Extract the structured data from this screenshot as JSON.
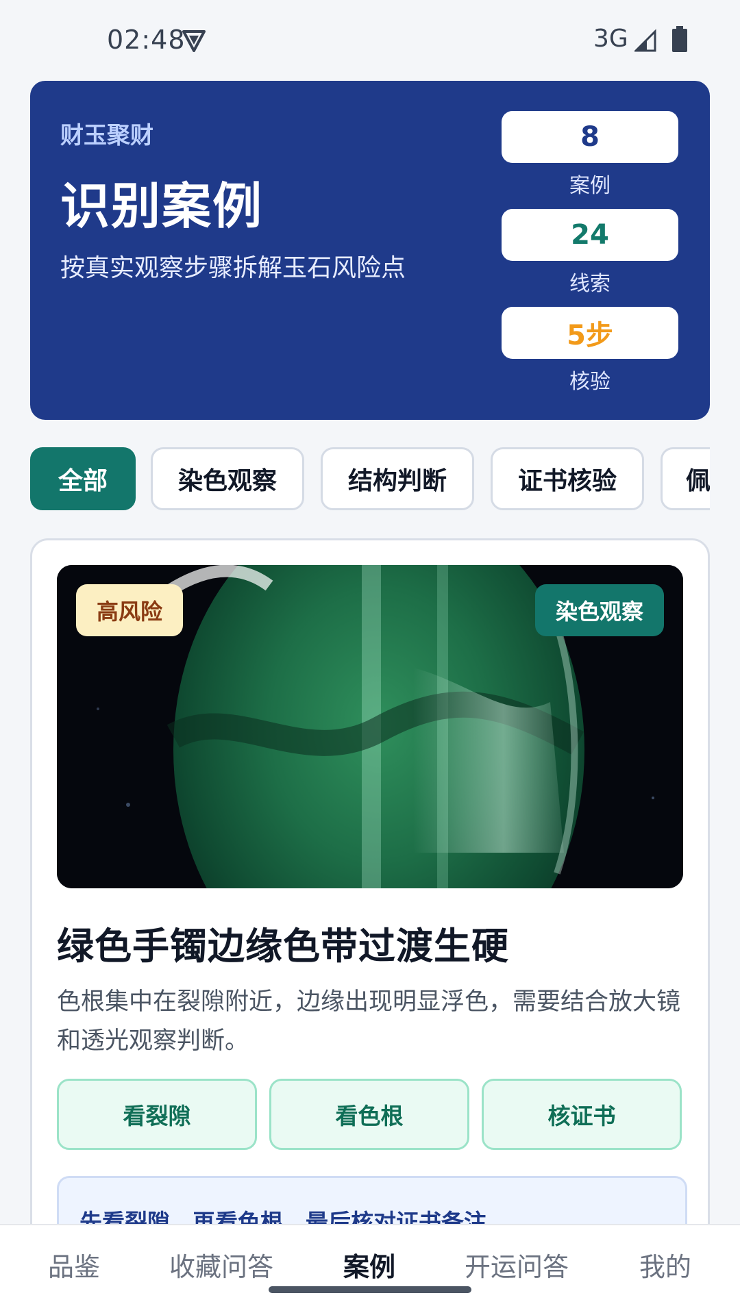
{
  "status_bar": {
    "time": "02:48",
    "network": "3G"
  },
  "hero": {
    "kicker": "财玉聚财",
    "title": "识别案例",
    "subtitle": "按真实观察步骤拆解玉石风险点",
    "stats": [
      {
        "value": "8",
        "label": "案例",
        "color": "#1f3a8a"
      },
      {
        "value": "24",
        "label": "线索",
        "color": "#137a6b"
      },
      {
        "value": "5步",
        "label": "核验",
        "color": "#f29a1a"
      }
    ]
  },
  "filters": [
    {
      "label": "全部",
      "active": true
    },
    {
      "label": "染色观察",
      "active": false
    },
    {
      "label": "结构判断",
      "active": false
    },
    {
      "label": "证书核验",
      "active": false
    },
    {
      "label": "佩",
      "active": false
    }
  ],
  "case_card": {
    "risk_badge": "高风险",
    "category_badge": "染色观察",
    "title": "绿色手镯边缘色带过渡生硬",
    "description": "色根集中在裂隙附近，边缘出现明显浮色，需要结合放大镜和透光观察判断。",
    "actions": [
      "看裂隙",
      "看色根",
      "核证书"
    ],
    "tip": "先看裂隙，再看色根，最后核对证书备注。"
  },
  "bottom_nav": [
    {
      "label": "品鉴",
      "active": false
    },
    {
      "label": "收藏问答",
      "active": false
    },
    {
      "label": "案例",
      "active": true
    },
    {
      "label": "开运问答",
      "active": false
    },
    {
      "label": "我的",
      "active": false
    }
  ]
}
